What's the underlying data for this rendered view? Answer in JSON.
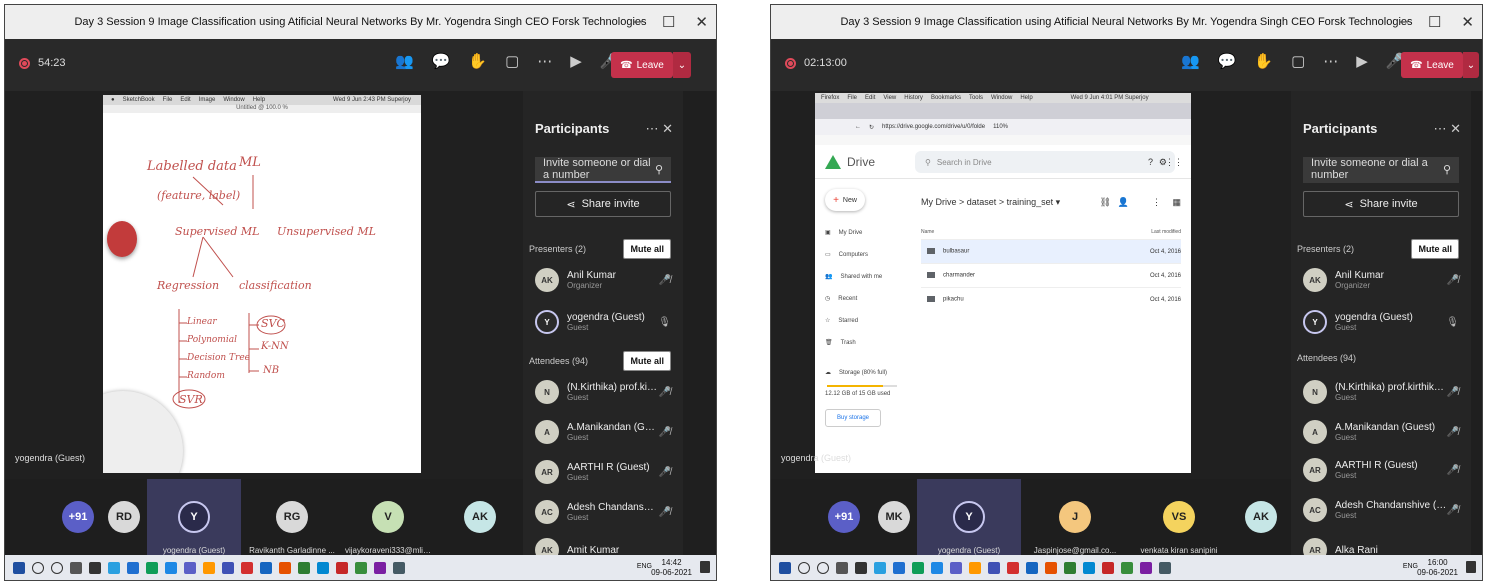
{
  "frames": [
    {
      "title": "Day 3 Session 9 Image Classification using Atificial Neural Networks By Mr. Yogendra Singh CEO Forsk Technologies",
      "timer": "54:23",
      "leave_label": "Leave",
      "presenter_label": "yogendra (Guest)",
      "panel": {
        "title": "Participants",
        "invite_placeholder": "Invite someone or dial a number",
        "share_label": "Share invite",
        "presenters_header": "Presenters (2)",
        "attendees_header": "Attendees (94)",
        "mute_all": "Mute all",
        "presenters": [
          {
            "initials": "AK",
            "name": "Anil Kumar",
            "role": "Organizer"
          },
          {
            "initials": "Y",
            "name": "yogendra (Guest)",
            "role": "Guest"
          }
        ],
        "attendees": [
          {
            "initials": "N",
            "name": "(N.Kirthika) prof.kirthika@gm...",
            "role": "Guest"
          },
          {
            "initials": "A",
            "name": "A.Manikandan (Guest)",
            "role": "Guest"
          },
          {
            "initials": "AR",
            "name": "AARTHI R (Guest)",
            "role": "Guest"
          },
          {
            "initials": "AC",
            "name": "Adesh Chandanshive (Guest)",
            "role": "Guest"
          },
          {
            "initials": "AK",
            "name": "Amit Kumar",
            "role": ""
          }
        ]
      },
      "tiles": [
        {
          "initials": "+91",
          "label": "",
          "color": "#5b5fc7"
        },
        {
          "initials": "RD",
          "label": "",
          "color": "#d9d9d9"
        },
        {
          "initials": "Y",
          "label": "yogendra (Guest)",
          "color": "#d9d9f3"
        },
        {
          "initials": "RG",
          "label": "Ravikanth Garladinne ...",
          "color": "#d9d9d9"
        },
        {
          "initials": "V",
          "label": "vijaykoraveni333@mlinsti...",
          "color": "#c6e0b4"
        },
        {
          "initials": "AK",
          "label": "",
          "color": "#c6e6e6"
        }
      ],
      "clock_time": "14:42",
      "clock_date": "09-06-2021",
      "lang": "ENG",
      "whiteboard": {
        "menu": [
          "SketchBook",
          "File",
          "Edit",
          "Image",
          "Window",
          "Help"
        ],
        "status": "Wed 9 Jun 2:43 PM  Superjoy",
        "doc_title": "Untitled @ 100.0 %",
        "notes": [
          "Labelled data",
          "ML",
          "(feature, label)",
          "Supervised ML",
          "Unsupervised ML",
          "Regression",
          "classification",
          "Linear",
          "Polynomial",
          "Decision Tree",
          "Random",
          "SVR",
          "SVC",
          "K-NN",
          "NB"
        ]
      }
    },
    {
      "title": "Day 3 Session 9 Image Classification using Atificial Neural Networks By Mr. Yogendra Singh CEO Forsk Technologies",
      "timer": "02:13:00",
      "leave_label": "Leave",
      "presenter_label": "yogendra (Guest)",
      "panel": {
        "title": "Participants",
        "invite_placeholder": "Invite someone or dial a number",
        "share_label": "Share invite",
        "presenters_header": "Presenters (2)",
        "attendees_header": "Attendees (94)",
        "mute_all": "Mute all",
        "presenters": [
          {
            "initials": "AK",
            "name": "Anil Kumar",
            "role": "Organizer"
          },
          {
            "initials": "Y",
            "name": "yogendra (Guest)",
            "role": "Guest"
          }
        ],
        "attendees": [
          {
            "initials": "N",
            "name": "(N.Kirthika) prof.kirthika@gm...",
            "role": "Guest"
          },
          {
            "initials": "A",
            "name": "A.Manikandan (Guest)",
            "role": "Guest"
          },
          {
            "initials": "AR",
            "name": "AARTHI R (Guest)",
            "role": "Guest"
          },
          {
            "initials": "AC",
            "name": "Adesh Chandanshive (Guest)",
            "role": "Guest"
          },
          {
            "initials": "AR",
            "name": "Alka Rani",
            "role": ""
          }
        ]
      },
      "tiles": [
        {
          "initials": "+91",
          "label": "",
          "color": "#5b5fc7"
        },
        {
          "initials": "MK",
          "label": "",
          "color": "#d9d9d9"
        },
        {
          "initials": "Y",
          "label": "yogendra (Guest)",
          "color": "#d9d9f3"
        },
        {
          "initials": "J",
          "label": "Jaspinjose@gmail.co...",
          "color": "#f4c77e"
        },
        {
          "initials": "VS",
          "label": "venkata kiran sanipini",
          "color": "#f4d35e"
        },
        {
          "initials": "AK",
          "label": "",
          "color": "#c6e6e6"
        }
      ],
      "clock_time": "16:00",
      "clock_date": "09-06-2021",
      "lang": "ENG",
      "drive": {
        "menu": [
          "Firefox",
          "File",
          "Edit",
          "View",
          "History",
          "Bookmarks",
          "Tools",
          "Window",
          "Help"
        ],
        "status": "Wed 9 Jun 4:01 PM  Superjoy",
        "url": "https://drive.google.com/drive/u/0/folde",
        "zoom": "110%",
        "logo": "Drive",
        "search_placeholder": "Search in Drive",
        "new_label": "New",
        "nav": [
          "My Drive",
          "Computers",
          "Shared with me",
          "Recent",
          "Starred",
          "Trash"
        ],
        "storage_label": "Storage (80% full)",
        "storage_used": "12.12 GB of 15 GB used",
        "storage_fraction": 0.8,
        "buy_storage": "Buy storage",
        "breadcrumb": [
          "My Drive",
          "dataset",
          "training_set"
        ],
        "col_name": "Name",
        "col_modified": "Last modified",
        "files": [
          {
            "name": "bulbasaur",
            "modified": "Oct 4, 2016"
          },
          {
            "name": "charmander",
            "modified": "Oct 4, 2016"
          },
          {
            "name": "pikachu",
            "modified": "Oct 4, 2016"
          }
        ]
      }
    }
  ]
}
